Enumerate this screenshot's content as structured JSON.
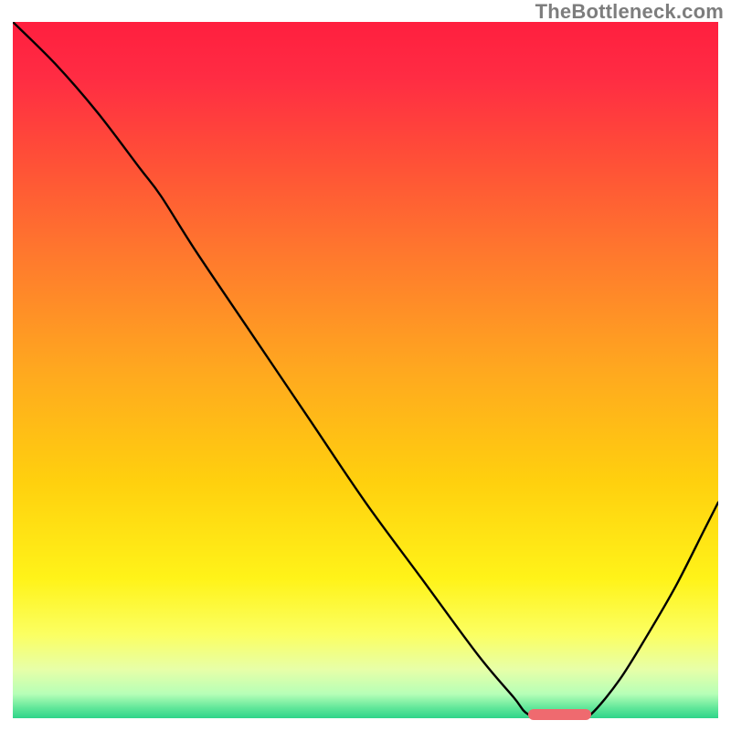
{
  "watermark": "TheBottleneck.com",
  "gradient_stops": [
    {
      "offset": 0.0,
      "color": "#ff1f3f"
    },
    {
      "offset": 0.08,
      "color": "#ff2c43"
    },
    {
      "offset": 0.2,
      "color": "#ff5037"
    },
    {
      "offset": 0.34,
      "color": "#ff7a2d"
    },
    {
      "offset": 0.5,
      "color": "#ffa81f"
    },
    {
      "offset": 0.66,
      "color": "#ffd00e"
    },
    {
      "offset": 0.8,
      "color": "#fff319"
    },
    {
      "offset": 0.88,
      "color": "#fbff62"
    },
    {
      "offset": 0.93,
      "color": "#e7ffa8"
    },
    {
      "offset": 0.965,
      "color": "#b7ffb7"
    },
    {
      "offset": 0.985,
      "color": "#62e79a"
    },
    {
      "offset": 1.0,
      "color": "#2fd48a"
    }
  ],
  "curve_color": "#000000",
  "curve_width": 2.4,
  "marker_color": "#ef6a6f",
  "chart_data": {
    "type": "line",
    "title": "",
    "xlabel": "",
    "ylabel": "",
    "xlim": [
      0,
      100
    ],
    "ylim": [
      0,
      100
    ],
    "notes": "Background is a vertical gradient (red→orange→yellow→green). Curve drops from top-left, has a slight inflection near x≈21, continues steeply down to a minimum flat segment near x≈73–82 at y≈0, then rises toward the right edge. Axes have no tick labels. Values below are estimated in 0–100 normalized coordinates (y=0 bottom, y=100 top).",
    "x": [
      0,
      6,
      12,
      18,
      21,
      26,
      34,
      42,
      50,
      58,
      66,
      71,
      73,
      76,
      80,
      82,
      86,
      90,
      94,
      98,
      100
    ],
    "y": [
      100,
      94,
      87,
      79,
      75,
      67,
      55,
      43,
      31,
      20,
      9,
      3,
      0.6,
      0,
      0,
      0.6,
      5.5,
      12,
      19,
      27,
      31
    ],
    "marker": {
      "x_start": 73,
      "x_end": 82,
      "y": 0,
      "color": "#ef6a6f"
    }
  }
}
